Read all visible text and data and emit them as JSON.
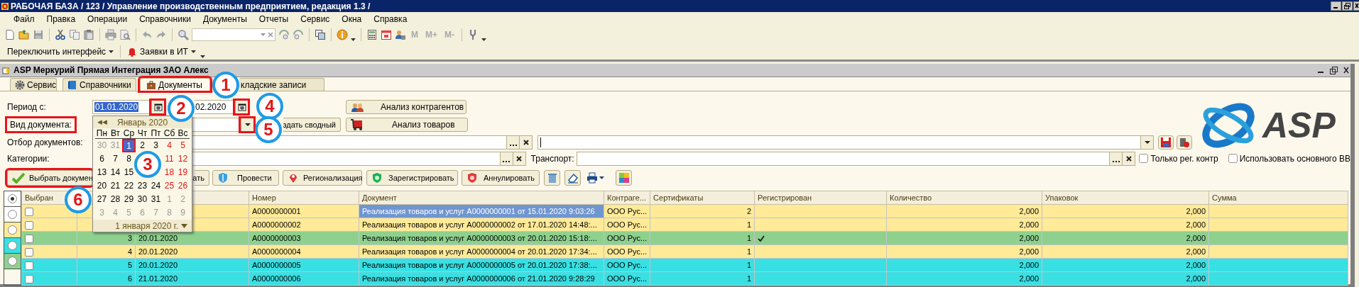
{
  "window": {
    "title": "РАБОЧАЯ БАЗА / 123 / Управление производственным предприятием, редакция 1.3 /"
  },
  "menu": [
    {
      "label": "Файл"
    },
    {
      "label": "Правка"
    },
    {
      "label": "Операции"
    },
    {
      "label": "Справочники"
    },
    {
      "label": "Документы"
    },
    {
      "label": "Отчеты"
    },
    {
      "label": "Сервис"
    },
    {
      "label": "Окна"
    },
    {
      "label": "Справка"
    }
  ],
  "memory_buttons": [
    {
      "label": "M",
      "disabled": true
    },
    {
      "label": "M+",
      "disabled": true
    },
    {
      "label": "M-",
      "disabled": true
    }
  ],
  "toolbar2": [
    {
      "label": "Переключить интерфейс"
    },
    {
      "label": "Заявки в ИТ"
    }
  ],
  "form": {
    "title": "ASP Меркурий Прямая Интеграция ЗАО Алекс"
  },
  "tabs": [
    {
      "label": "Сервис",
      "selected": false,
      "highlighted": false
    },
    {
      "label": "Справочники",
      "selected": false,
      "highlighted": false
    },
    {
      "label": "Документы",
      "selected": true,
      "highlighted": true
    },
    {
      "label": "кладские записи",
      "selected": false,
      "highlighted": false
    }
  ],
  "period": {
    "label": "Период с:",
    "from": "01.01.2020",
    "from_text_selected": true,
    "from_picker_highlighted": true,
    "to": "02.2020",
    "to_picker_highlighted": true
  },
  "doc_type": {
    "label": "Вид документа:",
    "highlighted": true,
    "dropdown_highlighted": true
  },
  "filter": {
    "label": "Отбор документов:"
  },
  "categories": {
    "label": "Категории:"
  },
  "transport": {
    "label": "Транспорт:"
  },
  "checkboxes": [
    {
      "label": "Только рег. контр",
      "checked": false
    },
    {
      "label": "Использовать основного ВВ",
      "checked": false
    }
  ],
  "side_buttons": [
    {
      "label": "Анализ контрагентов"
    },
    {
      "label": "здать сводный"
    },
    {
      "label": "Анализ товаров"
    }
  ],
  "actions": [
    {
      "label": "Выбрать докумен",
      "highlighted": true
    },
    {
      "label": "ать",
      "highlighted": false
    },
    {
      "label": "Провести",
      "highlighted": false
    },
    {
      "label": "Регионализация",
      "highlighted": false
    },
    {
      "label": "Зарегистрировать",
      "highlighted": false
    },
    {
      "label": "Аннулировать",
      "highlighted": false
    }
  ],
  "logo": {
    "text": "ASP"
  },
  "legend": [
    {
      "color": "#ffffff",
      "selected": true
    },
    {
      "color": "#ffffff",
      "selected": false
    },
    {
      "color": "#ffea98",
      "selected": false
    },
    {
      "color": "#38e0e3",
      "selected": false
    },
    {
      "color": "#8ed18e",
      "selected": false
    }
  ],
  "table": {
    "columns": [
      {
        "label": "Выбран"
      },
      {},
      {},
      {
        "label": "Номер"
      },
      {
        "label": "Документ"
      },
      {
        "label": "Контраге..."
      },
      {
        "label": "Сертификаты"
      },
      {
        "label": "Регистрирован"
      },
      {
        "label": "Количество"
      },
      {
        "label": "Упаковок"
      },
      {
        "label": "Сумма"
      }
    ],
    "rows": [
      {
        "color": "#ffea98",
        "selected": true,
        "checked": false,
        "number": "А0000000001",
        "document": "Реализация товаров и услуг А0000000001 от 15.01.2020 9:03:26",
        "counterparty": "ООО Рус...",
        "certificates": "2",
        "registered": false,
        "quantity": "2,000",
        "packages": "2,000"
      },
      {
        "color": "#ffea98",
        "selected": false,
        "checked": false,
        "number": "А0000000002",
        "document": "Реализация товаров и услуг А0000000002 от 17.01.2020 14:48:...",
        "counterparty": "ООО Рус...",
        "certificates": "1",
        "registered": false,
        "quantity": "2,000",
        "packages": "2,000"
      },
      {
        "color": "#8ed18e",
        "selected": false,
        "checked": false,
        "num": "3",
        "date": "20.01.2020",
        "number": "А0000000003",
        "document": "Реализация товаров и услуг А0000000003 от 20.01.2020 15:18:...",
        "counterparty": "ООО Рус...",
        "certificates": "1",
        "registered": true,
        "quantity": "2,000",
        "packages": "2,000"
      },
      {
        "color": "#ffea98",
        "selected": false,
        "checked": false,
        "num": "4",
        "date": "20.01.2020",
        "number": "А0000000004",
        "document": "Реализация товаров и услуг А0000000004 от 20.01.2020 17:34:...",
        "counterparty": "ООО Рус...",
        "certificates": "1",
        "registered": false,
        "quantity": "2,000",
        "packages": "2,000"
      },
      {
        "color": "#38e0e3",
        "selected": false,
        "checked": false,
        "num": "5",
        "date": "20.01.2020",
        "number": "А0000000005",
        "document": "Реализация товаров и услуг А0000000005 от 20.01.2020 17:38:...",
        "counterparty": "ООО Рус...",
        "certificates": "1",
        "registered": false,
        "quantity": "2,000",
        "packages": "2,000"
      },
      {
        "color": "#38e0e3",
        "selected": false,
        "checked": false,
        "num": "6",
        "date": "21.01.2020",
        "number": "А0000000006",
        "document": "Реализация товаров и услуг А0000000006 от 21.01.2020 9:28:29",
        "counterparty": "ООО Рус...",
        "certificates": "1",
        "registered": false,
        "quantity": "2,000",
        "packages": "2,000"
      }
    ]
  },
  "calendar": {
    "nav": "◀◀",
    "month": "Январь 2020",
    "weekdays": [
      "Пн",
      "Вт",
      "Ср",
      "Чт",
      "Пт",
      "Сб",
      "Вс"
    ],
    "weeks": [
      [
        {
          "text": "30",
          "kind": "other",
          "selected": false
        },
        {
          "text": "31",
          "kind": "other",
          "selected": false
        },
        {
          "text": "1",
          "kind": "weekday",
          "selected": true
        },
        {
          "text": "2",
          "kind": "weekday",
          "selected": false
        },
        {
          "text": "3",
          "kind": "weekday",
          "selected": false
        },
        {
          "text": "4",
          "kind": "weekend",
          "selected": false
        },
        {
          "text": "5",
          "kind": "weekend",
          "selected": false
        }
      ],
      [
        {
          "text": "6",
          "kind": "weekday",
          "selected": false
        },
        {
          "text": "7",
          "kind": "weekday",
          "selected": false
        },
        {
          "text": "8",
          "kind": "weekday",
          "selected": false
        },
        {
          "kind": "covered"
        },
        {
          "kind": "covered"
        },
        {
          "text": "11",
          "kind": "weekend",
          "selected": false
        },
        {
          "text": "12",
          "kind": "weekend",
          "selected": false
        }
      ],
      [
        {
          "text": "13",
          "kind": "weekday",
          "selected": false
        },
        {
          "text": "14",
          "kind": "weekday",
          "selected": false
        },
        {
          "text": "15",
          "kind": "weekday",
          "selected": false
        },
        {
          "kind": "covered"
        },
        {
          "kind": "covered"
        },
        {
          "text": "18",
          "kind": "weekend",
          "selected": false
        },
        {
          "text": "19",
          "kind": "weekend",
          "selected": false
        }
      ],
      [
        {
          "text": "20",
          "kind": "weekday",
          "selected": false
        },
        {
          "text": "21",
          "kind": "weekday",
          "selected": false
        },
        {
          "text": "22",
          "kind": "weekday",
          "selected": false
        },
        {
          "text": "23",
          "kind": "weekday",
          "selected": false
        },
        {
          "text": "24",
          "kind": "weekday",
          "selected": false
        },
        {
          "text": "25",
          "kind": "weekend",
          "selected": false
        },
        {
          "text": "26",
          "kind": "weekend",
          "selected": false
        }
      ],
      [
        {
          "text": "27",
          "kind": "weekday",
          "selected": false
        },
        {
          "text": "28",
          "kind": "weekday",
          "selected": false
        },
        {
          "text": "29",
          "kind": "weekday",
          "selected": false
        },
        {
          "text": "30",
          "kind": "weekday",
          "selected": false
        },
        {
          "text": "31",
          "kind": "weekday",
          "selected": false
        },
        {
          "text": "1",
          "kind": "other",
          "selected": false
        },
        {
          "text": "2",
          "kind": "other",
          "selected": false
        }
      ],
      [
        {
          "text": "3",
          "kind": "other",
          "selected": false
        },
        {
          "text": "4",
          "kind": "other",
          "selected": false
        },
        {
          "text": "5",
          "kind": "other",
          "selected": false
        },
        {
          "text": "6",
          "kind": "other",
          "selected": false
        },
        {
          "text": "7",
          "kind": "other",
          "selected": false
        },
        {
          "text": "8",
          "kind": "other",
          "selected": false
        },
        {
          "text": "9",
          "kind": "other",
          "selected": false
        }
      ]
    ],
    "footer": "1 января 2020 г."
  },
  "callouts": [
    "1",
    "2",
    "3",
    "4",
    "5",
    "6"
  ]
}
